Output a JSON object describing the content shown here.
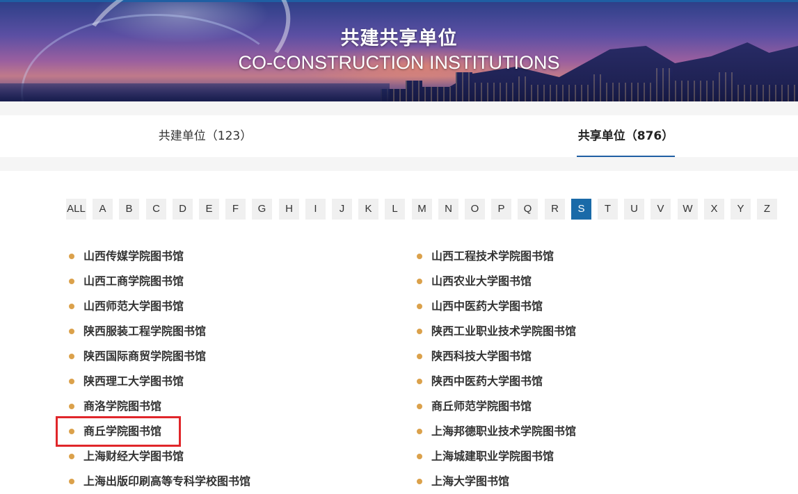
{
  "banner": {
    "title_cn": "共建共享单位",
    "title_en": "CO-CONSTRUCTION INSTITUTIONS"
  },
  "tabs": [
    {
      "label": "共建单位（123）",
      "active": false
    },
    {
      "label": "共享单位（876）",
      "active": true
    }
  ],
  "letters": [
    "ALL",
    "A",
    "B",
    "C",
    "D",
    "E",
    "F",
    "G",
    "H",
    "I",
    "J",
    "K",
    "L",
    "M",
    "N",
    "O",
    "P",
    "Q",
    "R",
    "S",
    "T",
    "U",
    "V",
    "W",
    "X",
    "Y",
    "Z"
  ],
  "active_letter": "S",
  "institutions_left": [
    "山西传媒学院图书馆",
    "山西工商学院图书馆",
    "山西师范大学图书馆",
    "陕西服装工程学院图书馆",
    "陕西国际商贸学院图书馆",
    "陕西理工大学图书馆",
    "商洛学院图书馆",
    "商丘学院图书馆",
    "上海财经大学图书馆",
    "上海出版印刷高等专科学校图书馆"
  ],
  "institutions_right": [
    "山西工程技术学院图书馆",
    "山西农业大学图书馆",
    "山西中医药大学图书馆",
    "陕西工业职业技术学院图书馆",
    "陕西科技大学图书馆",
    "陕西中医药大学图书馆",
    "商丘师范学院图书馆",
    "上海邦德职业技术学院图书馆",
    "上海城建职业学院图书馆",
    "上海大学图书馆"
  ],
  "colors": {
    "accent": "#1a6aa8",
    "bullet": "#dba14b",
    "highlight_box": "#e0262a"
  }
}
